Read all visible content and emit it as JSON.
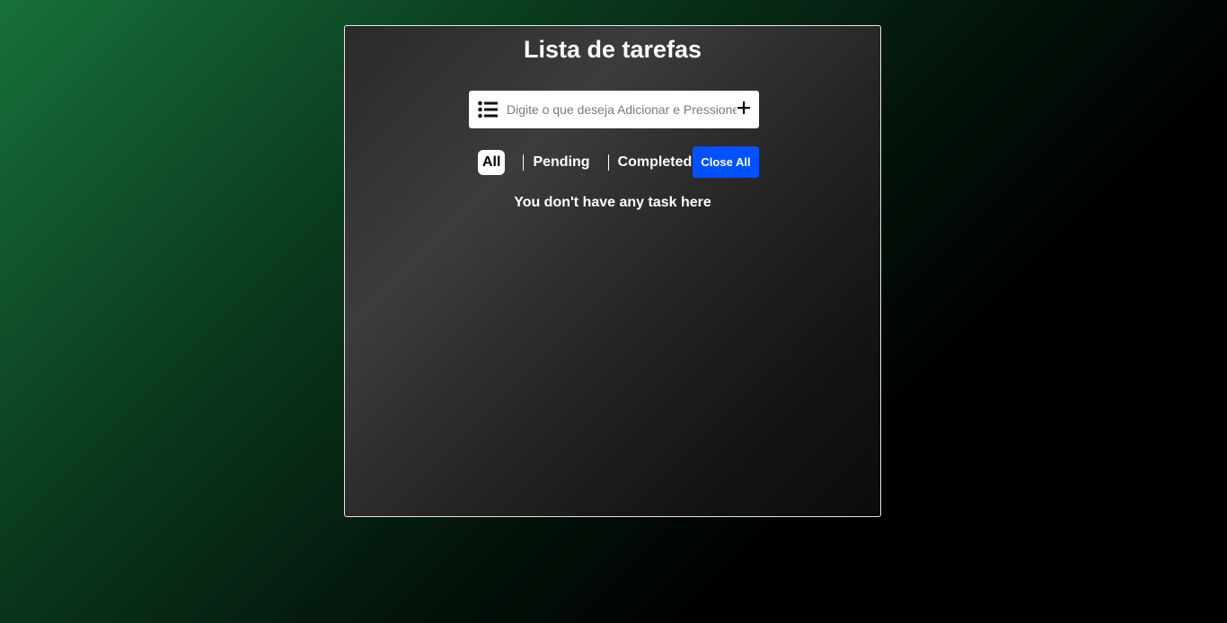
{
  "app": {
    "title": "Lista de tarefas"
  },
  "task_input": {
    "value": "",
    "placeholder": "Digite o que deseja Adicionar e Pressione Enter",
    "left_icon": "list-icon",
    "right_icon": "plus-icon"
  },
  "filters": {
    "all_label": "All",
    "pending_label": "Pending",
    "completed_label": "Completed",
    "active": "All"
  },
  "close_all_label": "Close All",
  "empty_message": "You don't have any task here",
  "colors": {
    "accent_button": "#0051ff",
    "background_green": "#17703a",
    "panel_border": "#e6e6e6"
  }
}
